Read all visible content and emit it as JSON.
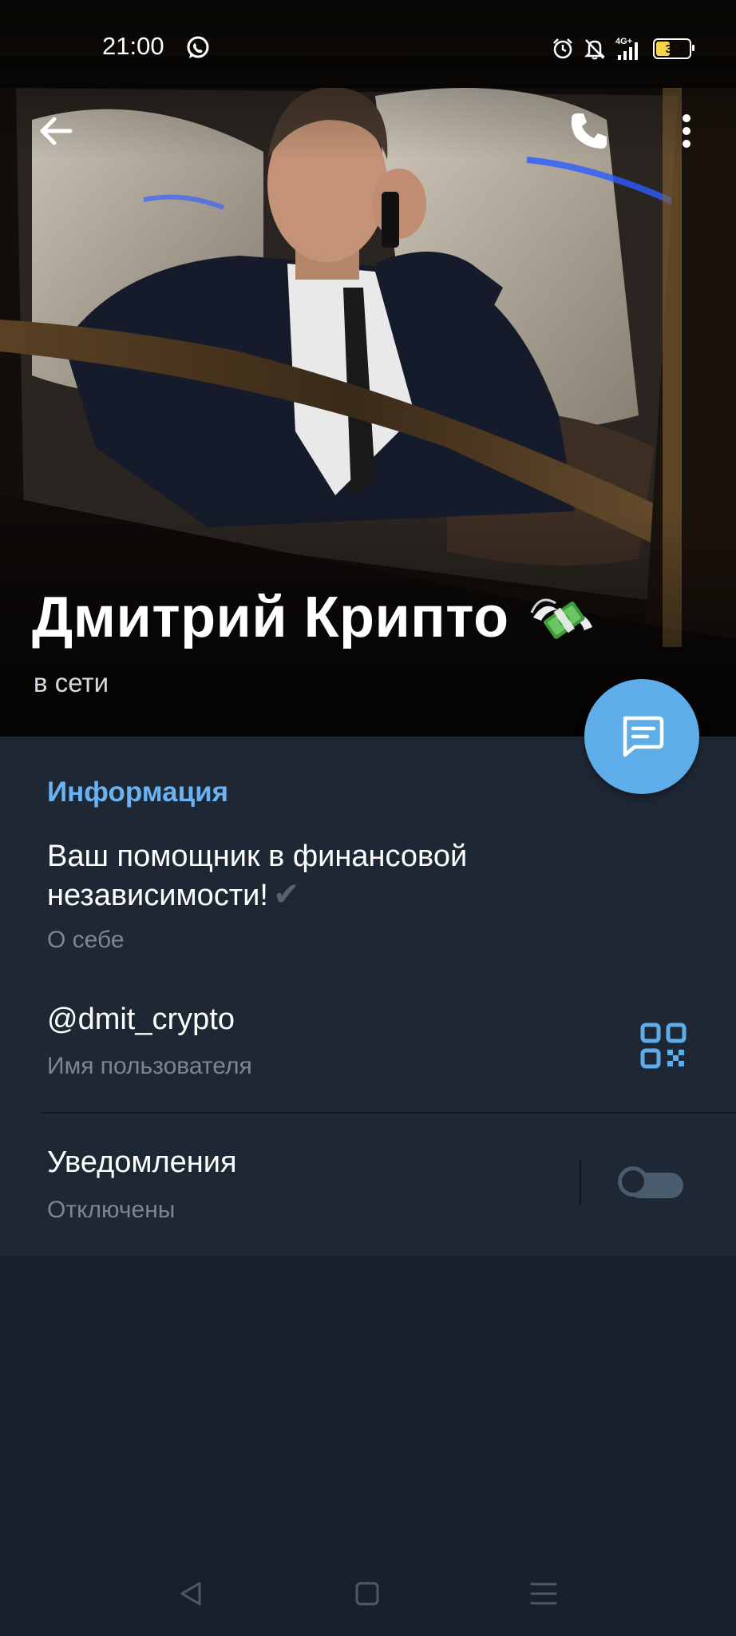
{
  "status_bar": {
    "time": "21:00",
    "network": "4G+",
    "battery_level": "36",
    "icons": [
      "whatsapp-icon",
      "alarm-icon",
      "bell-off-icon",
      "signal-icon",
      "battery-icon"
    ]
  },
  "header": {
    "name": "Дмитрий Крипто",
    "name_emoji": "money-with-wings",
    "status": "в сети",
    "actions": [
      "back-arrow-icon",
      "phone-icon",
      "more-vertical-icon"
    ]
  },
  "info": {
    "section_title": "Информация",
    "about_text": "Ваш помощник в финансовой независимости!",
    "about_check": "✔",
    "about_label": "О себе",
    "username": "@dmit_crypto",
    "username_label": "Имя пользователя",
    "notifications_title": "Уведомления",
    "notifications_status": "Отключены",
    "notifications_enabled": false
  },
  "colors": {
    "accent": "#6ab2f2",
    "fab": "#5eade9",
    "background": "#17202d",
    "panel": "#1e2734",
    "secondary_text": "#7c8694"
  },
  "navigation_bar": [
    "back-triangle-icon",
    "home-square-icon",
    "recents-menu-icon"
  ]
}
